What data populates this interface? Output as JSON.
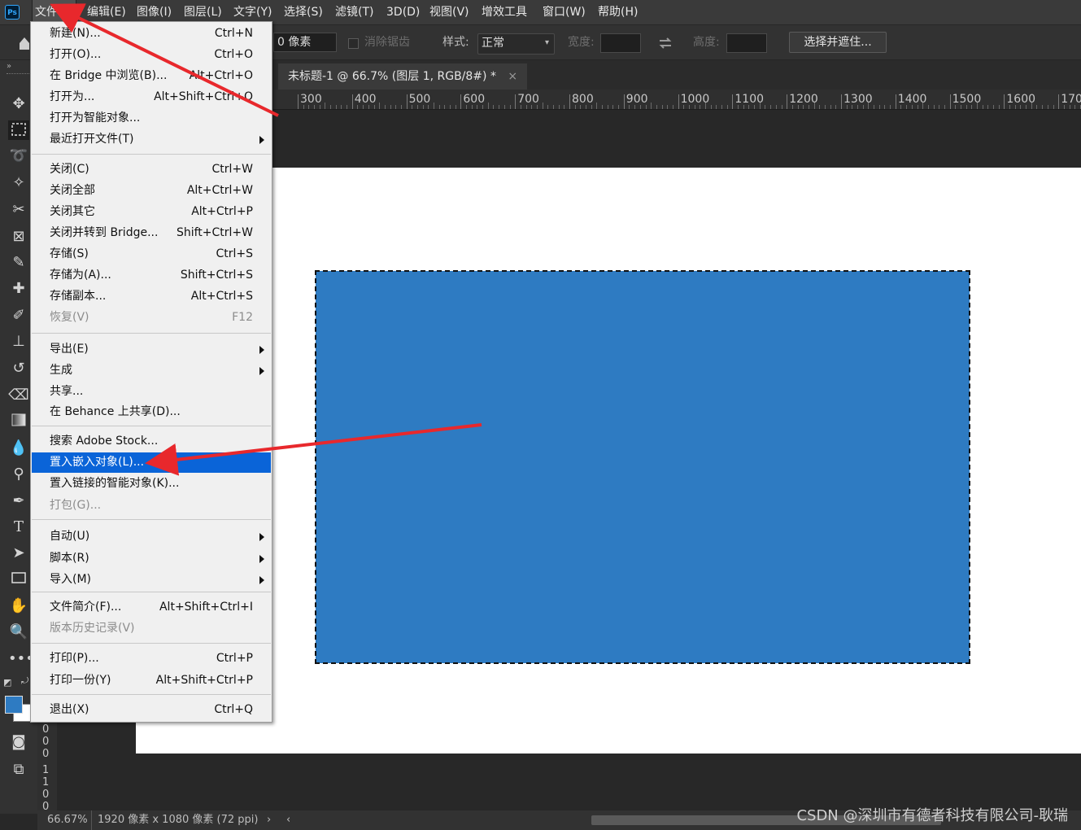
{
  "app": {
    "logo": "Ps"
  },
  "menubar": {
    "items": [
      {
        "label": "文件(F)"
      },
      {
        "label": "编辑(E)"
      },
      {
        "label": "图像(I)"
      },
      {
        "label": "图层(L)"
      },
      {
        "label": "文字(Y)"
      },
      {
        "label": "选择(S)"
      },
      {
        "label": "滤镜(T)"
      },
      {
        "label": "3D(D)"
      },
      {
        "label": "视图(V)"
      },
      {
        "label": "增效工具"
      },
      {
        "label": "窗口(W)"
      },
      {
        "label": "帮助(H)"
      }
    ]
  },
  "options": {
    "feather_value": "0 像素",
    "antialias_label": "消除锯齿",
    "style_label": "样式:",
    "style_value": "正常",
    "width_label": "宽度:",
    "height_label": "高度:",
    "select_mask_button": "选择并遮住..."
  },
  "document": {
    "tab_title": "未标题-1 @ 66.7% (图层 1, RGB/8#) *",
    "ruler_ticks": [
      "300",
      "400",
      "500",
      "600",
      "700",
      "800",
      "900",
      "1000",
      "1100",
      "1200",
      "1300",
      "1400",
      "1500",
      "1600",
      "1700"
    ],
    "vruler_labels": [
      "0",
      "0",
      "0",
      "1",
      "1",
      "0",
      "0"
    ]
  },
  "file_menu": {
    "groups": [
      [
        {
          "label": "新建(N)...",
          "shortcut": "Ctrl+N"
        },
        {
          "label": "打开(O)...",
          "shortcut": "Ctrl+O"
        },
        {
          "label": "在 Bridge 中浏览(B)...",
          "shortcut": "Alt+Ctrl+O"
        },
        {
          "label": "打开为...",
          "shortcut": "Alt+Shift+Ctrl+O"
        },
        {
          "label": "打开为智能对象...",
          "shortcut": ""
        },
        {
          "label": "最近打开文件(T)",
          "shortcut": "",
          "submenu": true
        }
      ],
      [
        {
          "label": "关闭(C)",
          "shortcut": "Ctrl+W"
        },
        {
          "label": "关闭全部",
          "shortcut": "Alt+Ctrl+W"
        },
        {
          "label": "关闭其它",
          "shortcut": "Alt+Ctrl+P"
        },
        {
          "label": "关闭并转到 Bridge...",
          "shortcut": "Shift+Ctrl+W"
        },
        {
          "label": "存储(S)",
          "shortcut": "Ctrl+S"
        },
        {
          "label": "存储为(A)...",
          "shortcut": "Shift+Ctrl+S"
        },
        {
          "label": "存储副本...",
          "shortcut": "Alt+Ctrl+S"
        },
        {
          "label": "恢复(V)",
          "shortcut": "F12",
          "disabled": true
        }
      ],
      [
        {
          "label": "导出(E)",
          "shortcut": "",
          "submenu": true
        },
        {
          "label": "生成",
          "shortcut": "",
          "submenu": true
        },
        {
          "label": "共享...",
          "shortcut": ""
        },
        {
          "label": "在 Behance 上共享(D)...",
          "shortcut": ""
        }
      ],
      [
        {
          "label": "搜索 Adobe Stock...",
          "shortcut": ""
        },
        {
          "label": "置入嵌入对象(L)...",
          "shortcut": "",
          "highlighted": true
        },
        {
          "label": "置入链接的智能对象(K)...",
          "shortcut": ""
        },
        {
          "label": "打包(G)...",
          "shortcut": "",
          "disabled": true
        }
      ],
      [
        {
          "label": "自动(U)",
          "shortcut": "",
          "submenu": true
        },
        {
          "label": "脚本(R)",
          "shortcut": "",
          "submenu": true
        },
        {
          "label": "导入(M)",
          "shortcut": "",
          "submenu": true
        }
      ],
      [
        {
          "label": "文件简介(F)...",
          "shortcut": "Alt+Shift+Ctrl+I"
        },
        {
          "label": "版本历史记录(V)",
          "shortcut": "",
          "disabled": true
        }
      ],
      [
        {
          "label": "打印(P)...",
          "shortcut": "Ctrl+P"
        },
        {
          "label": "打印一份(Y)",
          "shortcut": "Alt+Shift+Ctrl+P"
        }
      ],
      [
        {
          "label": "退出(X)",
          "shortcut": "Ctrl+Q"
        }
      ]
    ]
  },
  "status": {
    "zoom": "66.67%",
    "doc_info": "1920 像素 x 1080 像素 (72 ppi)"
  },
  "colors": {
    "foreground": "#2e7bc2",
    "background": "#ffffff",
    "highlight": "#0a64d8",
    "annotation": "#e8282c"
  },
  "watermark": "CSDN @深圳市有德者科技有限公司-耿瑞"
}
